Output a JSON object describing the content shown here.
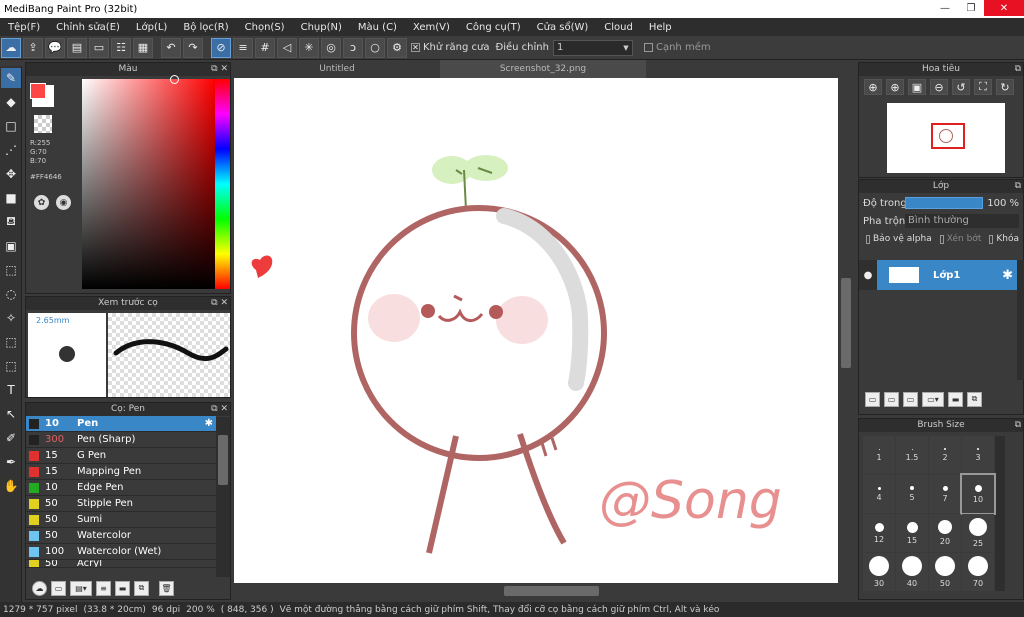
{
  "app": {
    "title": "MediBang Paint Pro (32bit)"
  },
  "menu": [
    "Tệp(F)",
    "Chỉnh sửa(E)",
    "Lớp(L)",
    "Bộ lọc(R)",
    "Chọn(S)",
    "Chụp(N)",
    "Màu (C)",
    "Xem(V)",
    "Công cụ(T)",
    "Cửa sổ(W)",
    "Cloud",
    "Help"
  ],
  "toolbar": {
    "antialias_label": "Khử răng cưa",
    "adjust_label": "Điều chỉnh",
    "adjust_value": "1",
    "smooth_label": "Cạnh mềm"
  },
  "color_panel": {
    "title": "Màu",
    "r": "R:255",
    "g": "G:70",
    "b": "B:70",
    "hex": "#FF4646",
    "fg": "#ff4646",
    "bg": "#ffffff"
  },
  "preview_panel": {
    "title": "Xem trước cọ",
    "size": "2.65mm"
  },
  "brush_panel": {
    "title": "Cọ: Pen",
    "items": [
      {
        "size": "10",
        "name": "Pen",
        "color": "#222222"
      },
      {
        "size": "300",
        "name": "Pen (Sharp)",
        "color": "#222222"
      },
      {
        "size": "15",
        "name": "G Pen",
        "color": "#e03030"
      },
      {
        "size": "15",
        "name": "Mapping Pen",
        "color": "#e03030"
      },
      {
        "size": "10",
        "name": "Edge Pen",
        "color": "#22aa22"
      },
      {
        "size": "50",
        "name": "Stipple Pen",
        "color": "#e0d020"
      },
      {
        "size": "50",
        "name": "Sumi",
        "color": "#e0d020"
      },
      {
        "size": "50",
        "name": "Watercolor",
        "color": "#6ec6f0"
      },
      {
        "size": "100",
        "name": "Watercolor (Wet)",
        "color": "#6ec6f0"
      },
      {
        "size": "50",
        "name": "Acryl",
        "color": "#e0d020"
      }
    ]
  },
  "tabs": [
    "Untitled",
    "Screenshot_32.png"
  ],
  "navigator": {
    "title": "Hoa tiêu"
  },
  "layer_panel": {
    "title": "Lớp",
    "opacity_label": "Độ trong",
    "opacity_value": "100 %",
    "blend_label": "Pha trộn",
    "blend_value": "Bình thường",
    "alpha_label": "Bảo vệ alpha",
    "clip_label": "Xén bớt",
    "lock_label": "Khóa",
    "layer_name": "Lớp1"
  },
  "brush_size_panel": {
    "title": "Brush Size",
    "sizes": [
      "1",
      "1.5",
      "2",
      "3",
      "4",
      "5",
      "7",
      "10",
      "12",
      "15",
      "20",
      "25",
      "30",
      "40",
      "50",
      "70"
    ]
  },
  "status": {
    "size": "1279 * 757 pixel",
    "cm": "(33.8 * 20cm)",
    "dpi": "96 dpi",
    "zoom": "200 %",
    "coords": "( 848, 356 )",
    "hint": "Vẽ một đường thẳng bằng cách giữ phím Shift, Thay đổi cỡ cọ bằng cách giữ phím Ctrl, Alt và kéo"
  },
  "artwork": {
    "signature": "@Song"
  }
}
